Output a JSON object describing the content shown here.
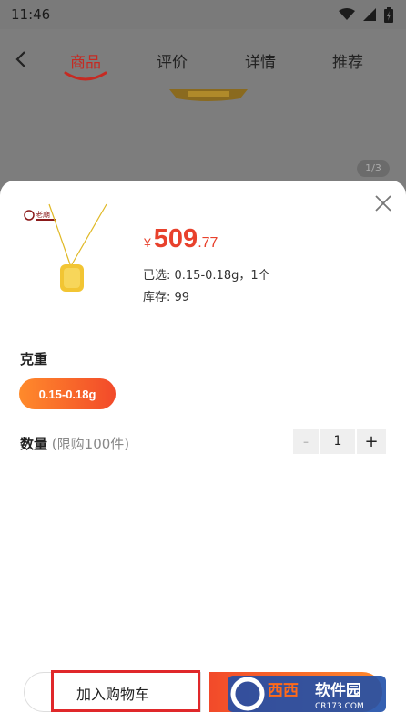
{
  "status_bar": {
    "time": "11:46"
  },
  "header": {
    "tabs": [
      {
        "label": "商品"
      },
      {
        "label": "评价"
      },
      {
        "label": "详情"
      },
      {
        "label": "推荐"
      }
    ],
    "active_color": "#c62a22"
  },
  "gallery": {
    "indicator": "1/3"
  },
  "product": {
    "price_symbol": "¥",
    "price_integer": "509",
    "price_decimal": ".77",
    "selected": "已选: 0.15-0.18g，1个",
    "stock": "库存: 99",
    "brand_text": "老庙"
  },
  "spec": {
    "weight_label": "克重",
    "weight_option": "0.15-0.18g"
  },
  "quantity": {
    "label": "数量",
    "limit": "(限购100件)",
    "minus": "-",
    "value": "1",
    "plus": "+"
  },
  "actions": {
    "add_to_cart": "加入购物车"
  },
  "watermark": {
    "name": "西西软件园",
    "site": "CR173.COM"
  },
  "colors": {
    "accent": "#e8412c",
    "gradient_start": "#ff8a2b",
    "gradient_end": "#f24a2a"
  }
}
